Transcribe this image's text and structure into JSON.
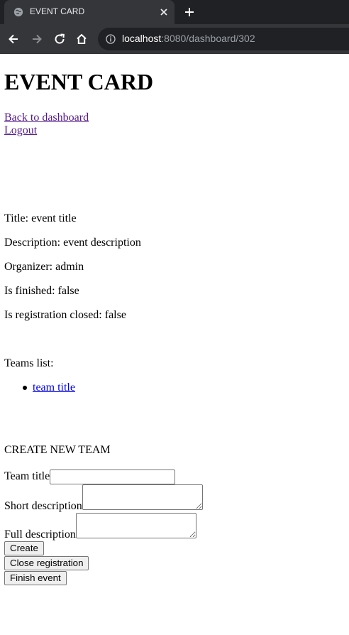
{
  "browser": {
    "tab_title": "EVENT CARD",
    "url_host": "localhost",
    "url_rest": ":8080/dashboard/302",
    "icons": {
      "favicon": "globe-icon",
      "close": "close-icon",
      "new_tab": "plus-icon",
      "back": "arrow-left-icon",
      "forward": "arrow-right-icon",
      "reload": "reload-icon",
      "home": "home-icon",
      "info": "info-icon"
    },
    "colors": {
      "tabbar": "#202124",
      "toolbar": "#35363a",
      "omnibox": "#202124"
    }
  },
  "page": {
    "heading": "EVENT CARD",
    "back_link": "Back to dashboard",
    "logout_link": "Logout",
    "details": {
      "title": "Title: event title",
      "description": "Description: event description",
      "organizer": "Organizer: admin",
      "is_finished": "Is finished: false",
      "is_registration_closed": "Is registration closed: false"
    },
    "teams_label": "Teams list:",
    "teams": [
      "team title"
    ],
    "create_heading": "CREATE NEW TEAM",
    "form": {
      "team_title_label": "Team title",
      "short_description_label": "Short description",
      "full_description_label": "Full description",
      "team_title_value": "",
      "short_description_value": "",
      "full_description_value": ""
    },
    "buttons": {
      "create": "Create",
      "close_registration": "Close registration",
      "finish_event": "Finish event"
    },
    "colors": {
      "visited_link": "#551a8b",
      "link": "#0000ee"
    }
  }
}
